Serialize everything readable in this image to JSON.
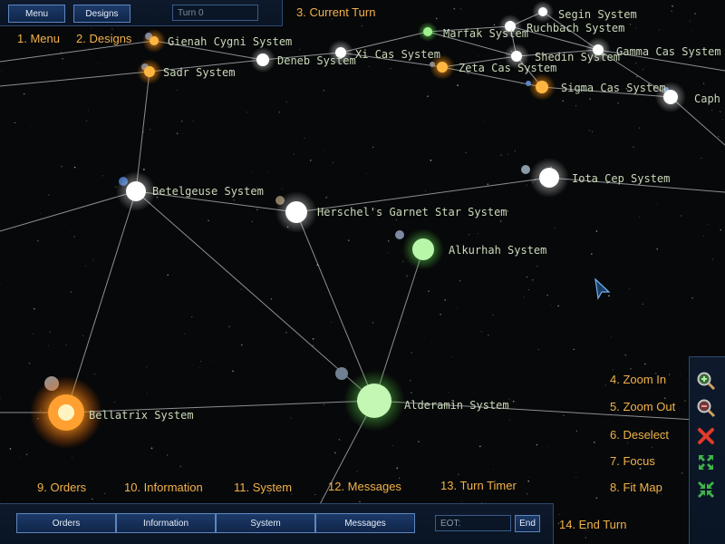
{
  "top_bar": {
    "menu_label": "Menu",
    "designs_label": "Designs",
    "turn_field": "Turn 0"
  },
  "bottom_bar": {
    "tabs": [
      "Orders",
      "Information",
      "System",
      "Messages"
    ],
    "eot_placeholder": "EOT:",
    "end_label": "End"
  },
  "callouts": {
    "menu": "1. Menu",
    "designs": "2. Designs",
    "current_turn": "3. Current Turn",
    "zoom_in": "4. Zoom In",
    "zoom_out": "5. Zoom Out",
    "deselect": "6. Deselect",
    "focus": "7. Focus",
    "fit_map": "8. Fit Map",
    "orders": "9. Orders",
    "information": "10. Information",
    "system": "11. System",
    "messages": "12. Messages",
    "turn_timer": "13. Turn Timer",
    "end_turn": "14. End Turn"
  },
  "systems": [
    "Segin System",
    "Ruchbach System",
    "Marfak System",
    "Gamma Cas System",
    "Shedin System",
    "Gienah Cygni System",
    "Deneb System",
    "Xi Cas System",
    "Zeta Cas System",
    "Sadr System",
    "Sigma Cas System",
    "Caph",
    "Iota Cep System",
    "Betelgeuse System",
    "Herschel's Garnet Star System",
    "Alkurhah System",
    "Alderamin System",
    "Bellatrix System"
  ],
  "star_colors": {
    "white": "#ffffff",
    "orange": "#ffa030",
    "green": "#7fe87a",
    "red_giant": "#ff8a20"
  },
  "side_icons": [
    "zoom-in-icon",
    "zoom-out-icon",
    "close-icon",
    "focus-icon",
    "fit-map-icon"
  ]
}
